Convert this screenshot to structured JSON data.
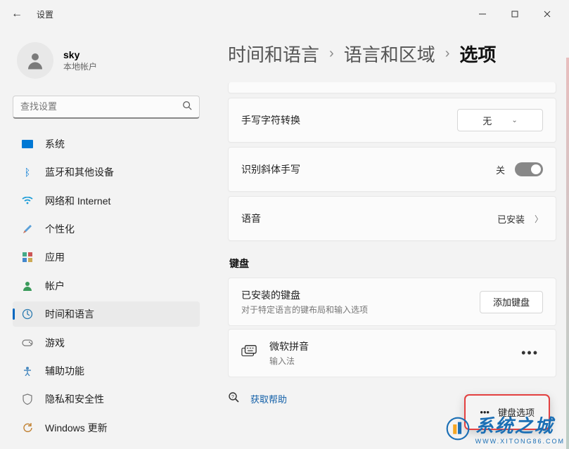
{
  "title": "设置",
  "user": {
    "name": "sky",
    "account": "本地帐户"
  },
  "search": {
    "placeholder": "查找设置"
  },
  "nav": {
    "items": [
      "系统",
      "蓝牙和其他设备",
      "网络和 Internet",
      "个性化",
      "应用",
      "帐户",
      "时间和语言",
      "游戏",
      "辅助功能",
      "隐私和安全性",
      "Windows 更新"
    ]
  },
  "breadcrumbs": {
    "a": "时间和语言",
    "b": "语言和区域",
    "c": "选项"
  },
  "options": {
    "handwriting": {
      "label": "手写字符转换",
      "value": "无"
    },
    "italic": {
      "label": "识别斜体手写",
      "state": "关"
    },
    "voice": {
      "label": "语音",
      "status": "已安装"
    }
  },
  "keyboard": {
    "section": "键盘",
    "installed": {
      "title": "已安装的键盘",
      "desc": "对于特定语言的键布局和输入选项"
    },
    "add": "添加键盘",
    "ime": {
      "name": "微软拼音",
      "desc": "输入法"
    },
    "menu": "键盘选项"
  },
  "help": "获取帮助",
  "watermark": {
    "zh": "系统之城",
    "py": "WWW.XITONG86.COM"
  }
}
